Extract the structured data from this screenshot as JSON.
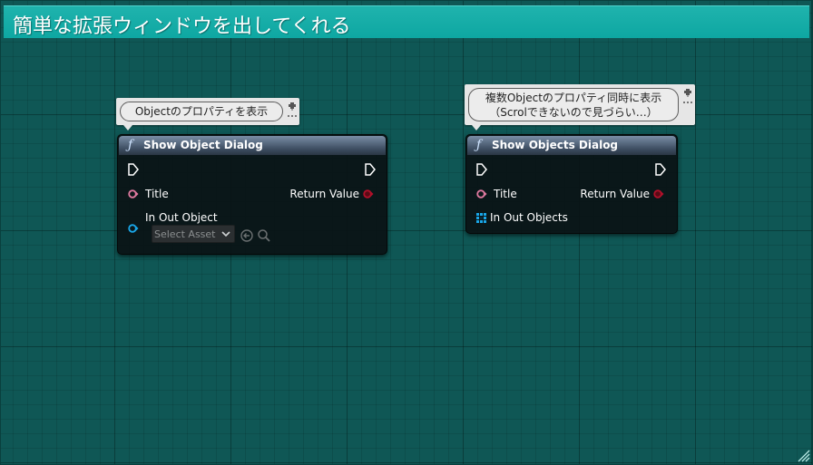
{
  "comment": {
    "title": "簡単な拡張ウィンドウを出してくれる"
  },
  "node1": {
    "bubble_text": "Objectのプロパティを表示",
    "title": "Show Object Dialog",
    "pin_title": "Title",
    "pin_return": "Return Value",
    "pin_in_out": "In Out Object",
    "asset_select": "Select Asset"
  },
  "node2": {
    "bubble_line1": "複数Objectのプロパティ同時に表示",
    "bubble_line2": "（Scrolできないので見づらい…）",
    "title": "Show Objects Dialog",
    "pin_title": "Title",
    "pin_return": "Return Value",
    "pin_in_out": "In Out Objects"
  },
  "colors": {
    "grid_bg": "#0f5755",
    "comment_header": "#0ea7a2",
    "string_pin": "#e07aa0",
    "object_pin": "#19a6e8",
    "return_pin": "#b0102a"
  }
}
